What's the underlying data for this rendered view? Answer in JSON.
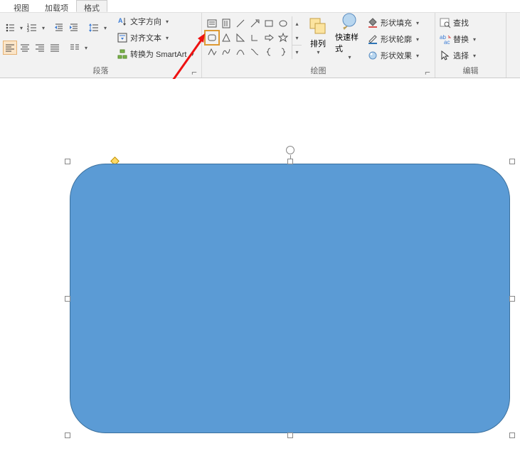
{
  "tabs": {
    "view": "视图",
    "addins": "加载项",
    "format": "格式"
  },
  "groups": {
    "paragraph": "段落",
    "drawing": "绘图",
    "editing": "编辑"
  },
  "paragraph": {
    "text_direction": "文字方向",
    "align_text": "对齐文本",
    "convert_smartart": "转换为 SmartArt"
  },
  "drawing": {
    "arrange": "排列",
    "quick_styles": "快速样式",
    "shape_fill": "形状填充",
    "shape_outline": "形状轮廓",
    "shape_effects": "形状效果"
  },
  "editing": {
    "find": "查找",
    "replace": "替换",
    "select": "选择"
  },
  "shapes": [
    "text-box",
    "vtext-box",
    "line",
    "line-arrow",
    "rectangle",
    "oval",
    "rounded-rect",
    "triangle",
    "rt-triangle",
    "l-shape",
    "right-arrow",
    "star",
    "freeform",
    "curve",
    "arc",
    "connector",
    "left-brace",
    "right-brace"
  ],
  "chart_data": null
}
